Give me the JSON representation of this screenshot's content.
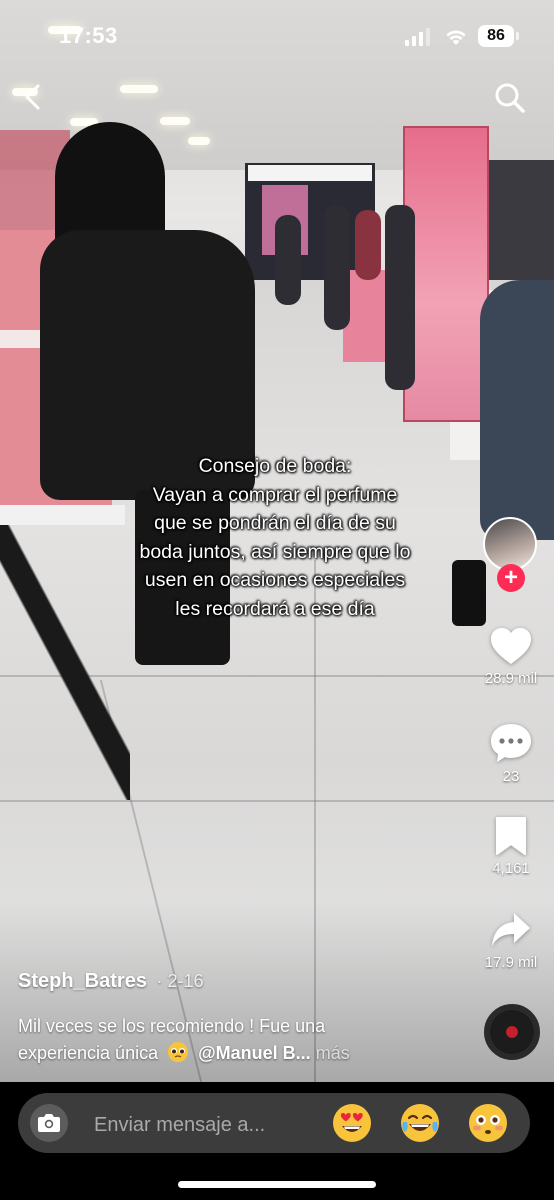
{
  "status_bar": {
    "time": "17:53",
    "battery": "86"
  },
  "video": {
    "caption_lines": [
      "Consejo de boda:",
      "Vayan a comprar el perfume",
      "que se pondrán el día de su",
      "boda juntos, así siempre que lo",
      "usen en ocasiones especiales",
      "les recordará a ese día"
    ]
  },
  "actions": {
    "likes": "28.9 mil",
    "comments": "23",
    "saves": "4,161",
    "shares": "17.9 mil"
  },
  "post": {
    "author": "Steph_Batres",
    "date": "· 2-16",
    "description_line1": "Mil veces se los recomiendo ! Fue una",
    "description_line2_prefix": "experiencia única",
    "mention": "@Manuel B...",
    "more_label": "más"
  },
  "bottom_bar": {
    "placeholder": "Enviar mensaje a...",
    "quick_reactions": [
      "heart-eyes",
      "tears-of-joy",
      "flushed"
    ]
  },
  "colors": {
    "accent": "#fe2c55",
    "input_bg": "#3c3c3c"
  }
}
